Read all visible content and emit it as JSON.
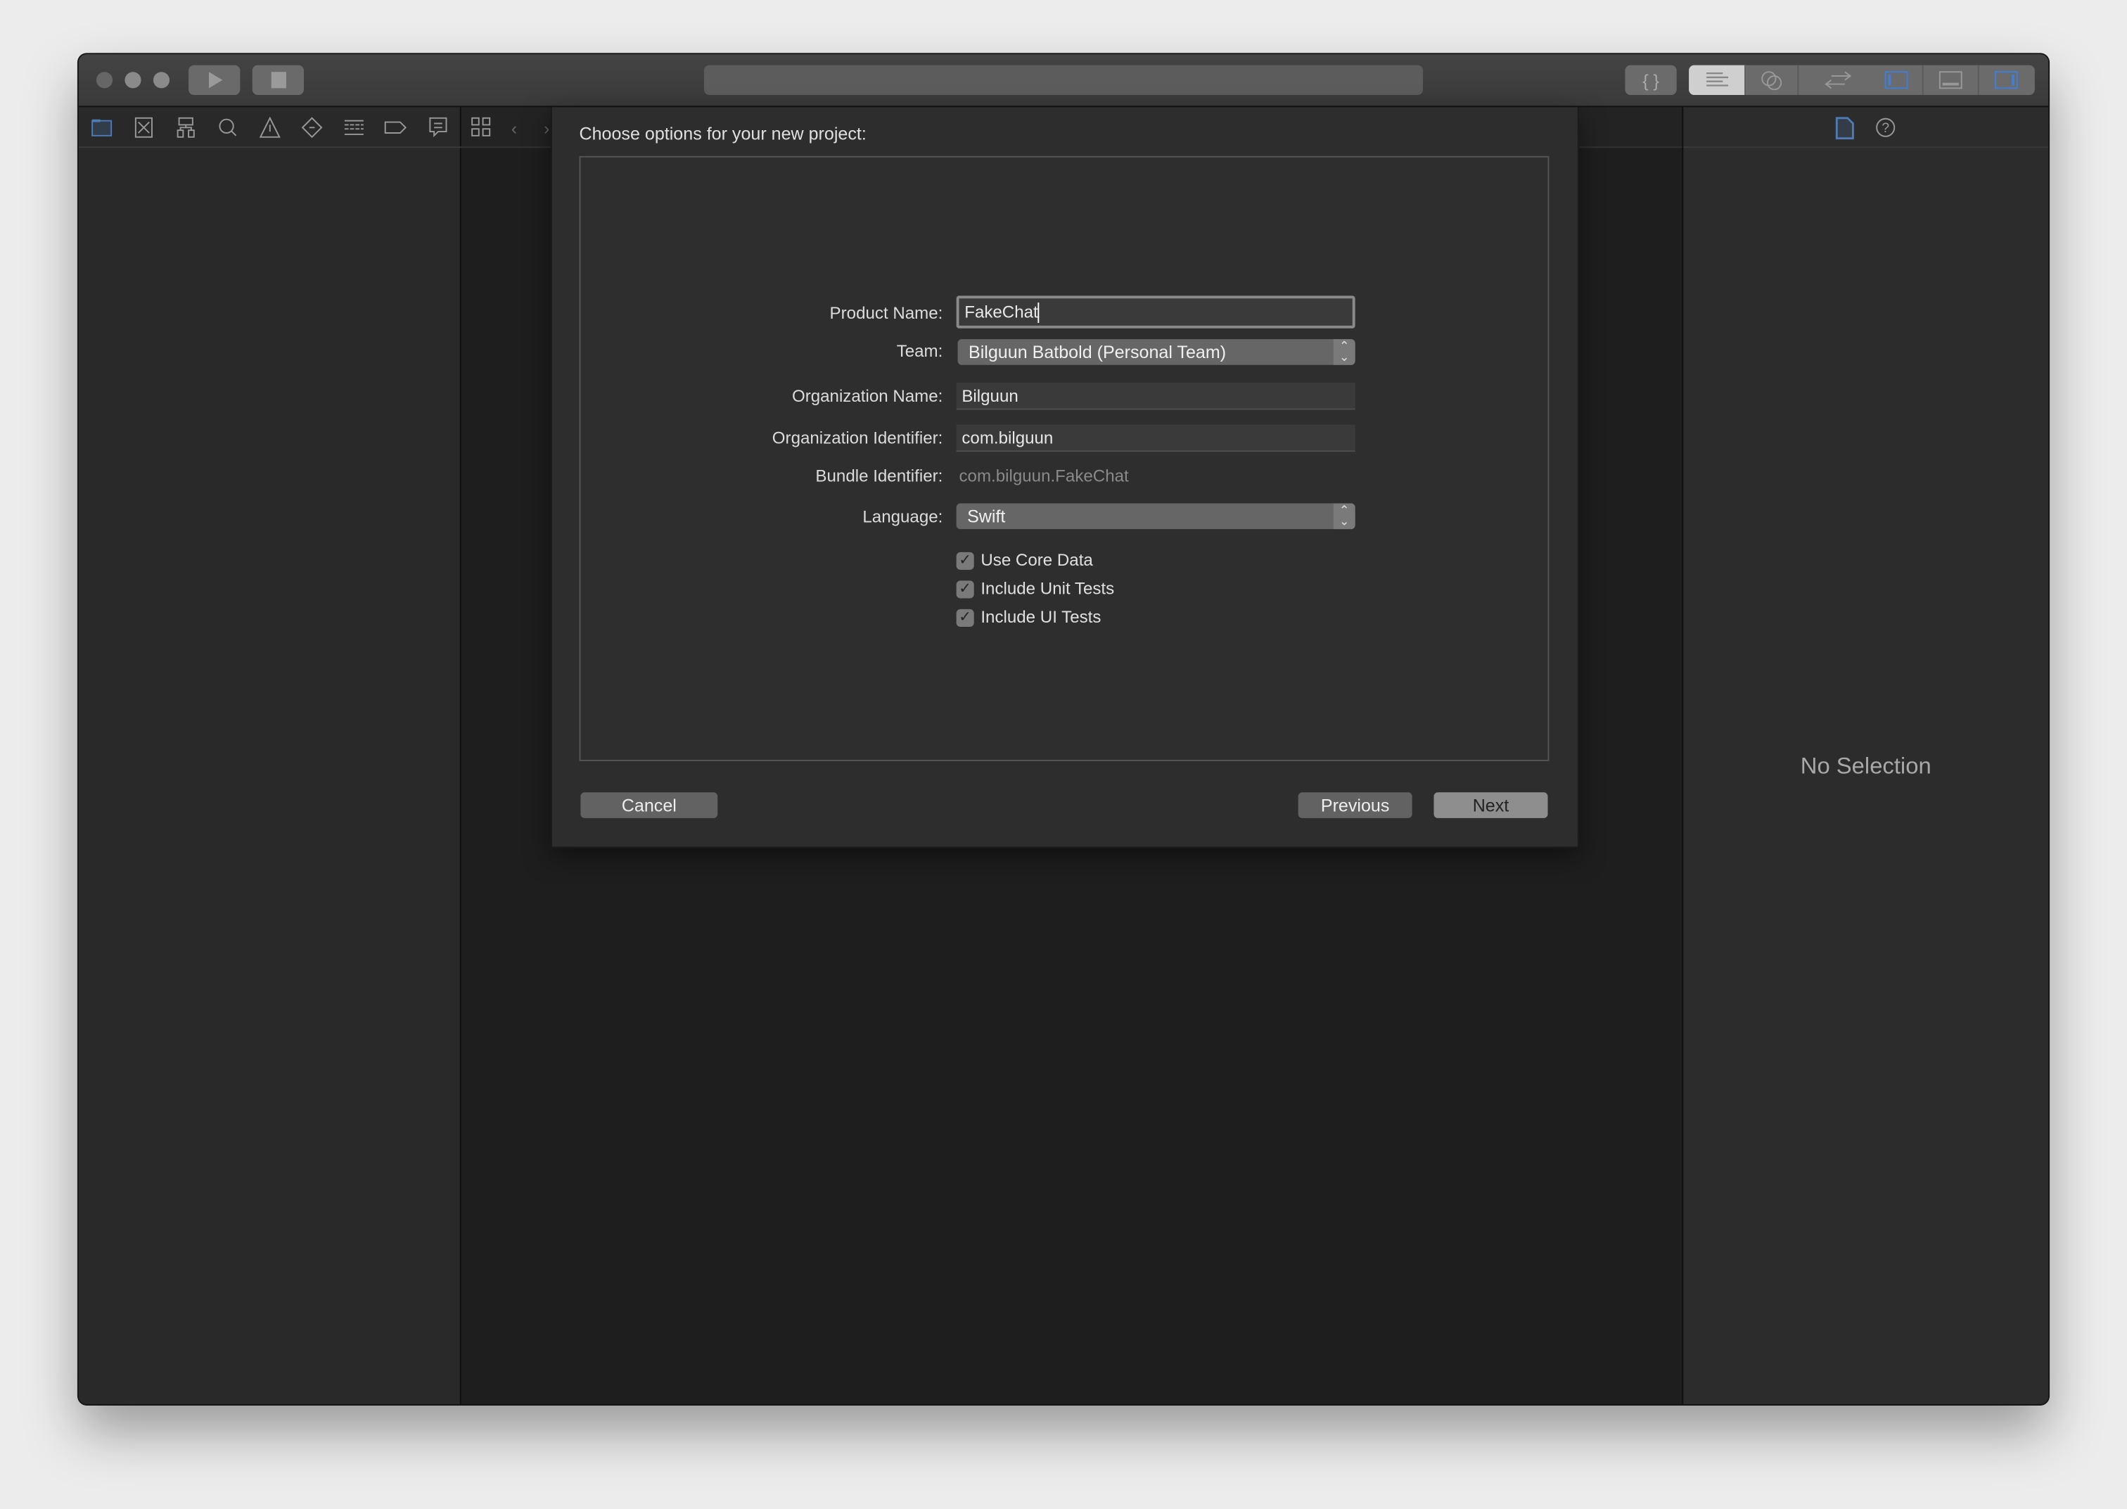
{
  "toolbar": {
    "run_icon": "play-icon",
    "stop_icon": "stop-icon",
    "editor_modes": [
      "standard-editor-icon",
      "assistant-editor-icon",
      "version-editor-icon"
    ],
    "panels": [
      "navigator-panel-icon",
      "debug-area-icon",
      "inspector-panel-icon"
    ],
    "accent": "#3f7fd8"
  },
  "navigator": {
    "icons": [
      "folder-icon",
      "source-control-icon",
      "symbol-hierarchy-icon",
      "search-icon",
      "warning-icon",
      "test-diamond-icon",
      "debug-list-icon",
      "breakpoint-tag-icon",
      "report-bubble-icon"
    ]
  },
  "inspector": {
    "icons": [
      "file-icon",
      "help-icon"
    ],
    "empty_text": "No Selection"
  },
  "sheet": {
    "title": "Choose options for your new project:",
    "fields": {
      "product_name": {
        "label": "Product Name:",
        "value": "FakeChat"
      },
      "team": {
        "label": "Team:",
        "value": "Bilguun Batbold (Personal Team)"
      },
      "org_name": {
        "label": "Organization Name:",
        "value": "Bilguun"
      },
      "org_id": {
        "label": "Organization Identifier:",
        "value": "com.bilguun"
      },
      "bundle_id": {
        "label": "Bundle Identifier:",
        "value": "com.bilguun.FakeChat"
      },
      "language": {
        "label": "Language:",
        "value": "Swift"
      }
    },
    "checkboxes": [
      {
        "label": "Use Core Data",
        "checked": true
      },
      {
        "label": "Include Unit Tests",
        "checked": true
      },
      {
        "label": "Include UI Tests",
        "checked": true
      }
    ],
    "buttons": {
      "cancel": "Cancel",
      "previous": "Previous",
      "next": "Next"
    }
  }
}
